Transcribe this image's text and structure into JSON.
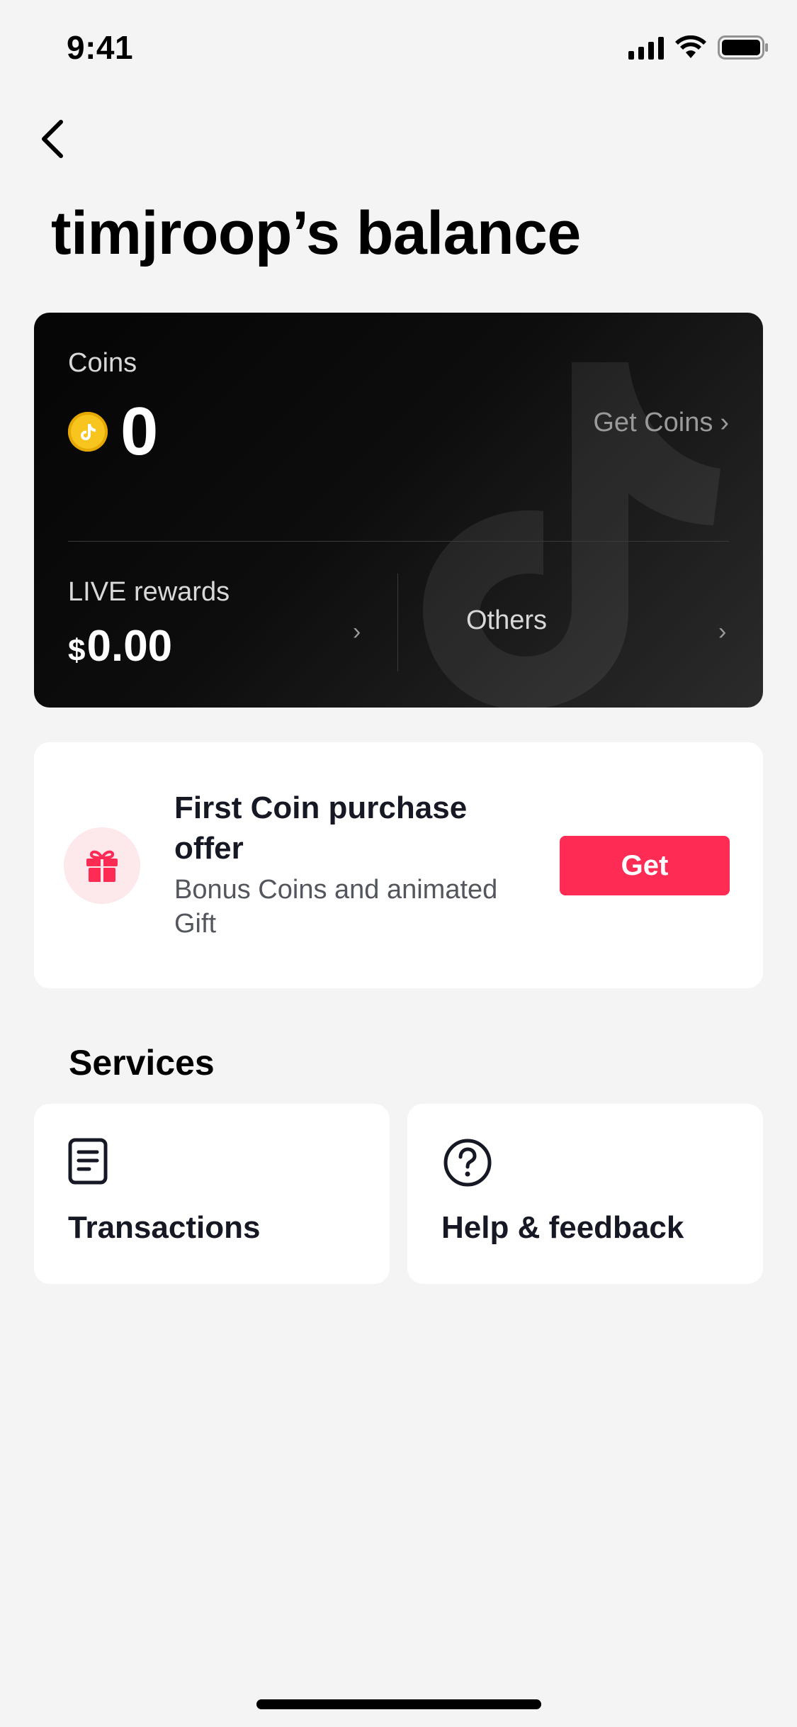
{
  "status_bar": {
    "time": "9:41"
  },
  "page": {
    "title": "timjroop’s balance"
  },
  "balance_card": {
    "coins_label": "Coins",
    "coins_value": "0",
    "get_coins_label": "Get Coins",
    "live_rewards_label": "LIVE rewards",
    "live_rewards_currency": "$",
    "live_rewards_amount": "0.00",
    "others_label": "Others",
    "chevron": "›"
  },
  "offer": {
    "title": "First Coin purchase offer",
    "subtitle": "Bonus Coins and animated Gift",
    "button_label": "Get"
  },
  "services": {
    "heading": "Services",
    "items": [
      {
        "label": "Transactions",
        "icon": "document-icon"
      },
      {
        "label": "Help & feedback",
        "icon": "question-circle-icon"
      }
    ]
  },
  "colors": {
    "accent": "#fe2c55",
    "coin": "#f7c51d",
    "card_dark": "#0d0d0d",
    "background": "#f4f4f4"
  }
}
